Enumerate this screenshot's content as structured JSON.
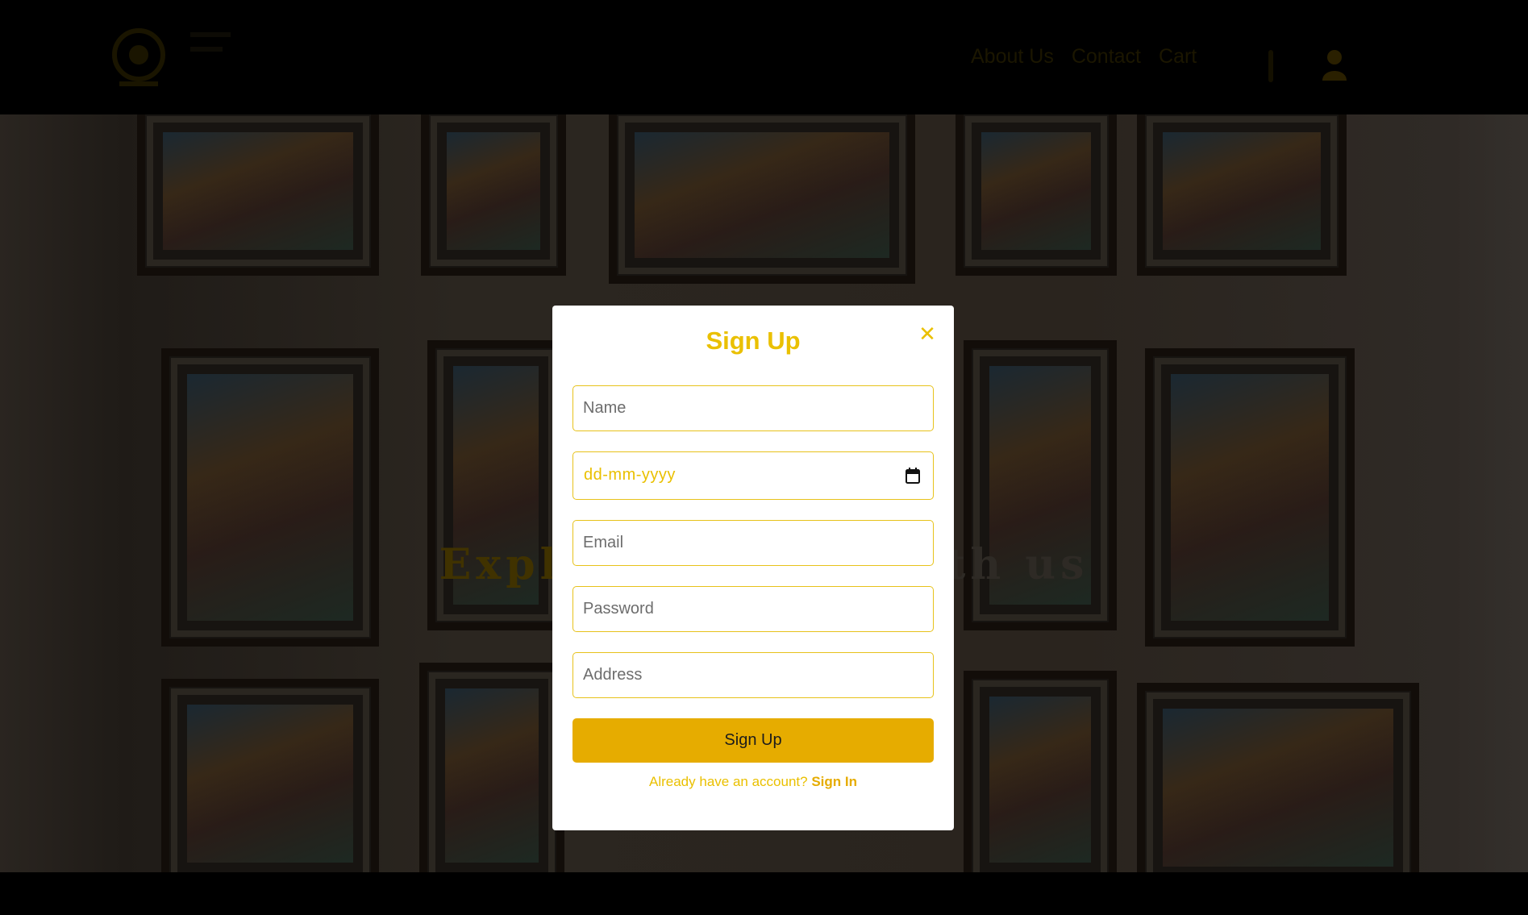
{
  "header": {
    "logo_icon": "brand-emblem-icon",
    "nav": [
      {
        "label": "About Us"
      },
      {
        "label": "Contact"
      },
      {
        "label": "Cart"
      }
    ],
    "menu_icon": "vertical-dots-icon",
    "user_icon": "user-icon"
  },
  "hero": {
    "title_accent": "Explore",
    "title_rest": "the art with us"
  },
  "modal": {
    "title": "Sign Up",
    "close_icon": "close-icon",
    "name_placeholder": "Name",
    "dob_placeholder": "dd-mm-yyyy",
    "calendar_icon": "calendar-icon",
    "email_placeholder": "Email",
    "password_placeholder": "Password",
    "address_placeholder": "Address",
    "submit_label": "Sign Up",
    "signin_prompt": "Already have an account?",
    "signin_link": "Sign In"
  },
  "colors": {
    "accent": "#eac000",
    "button": "#e6ac00",
    "overlay": "#000000"
  }
}
